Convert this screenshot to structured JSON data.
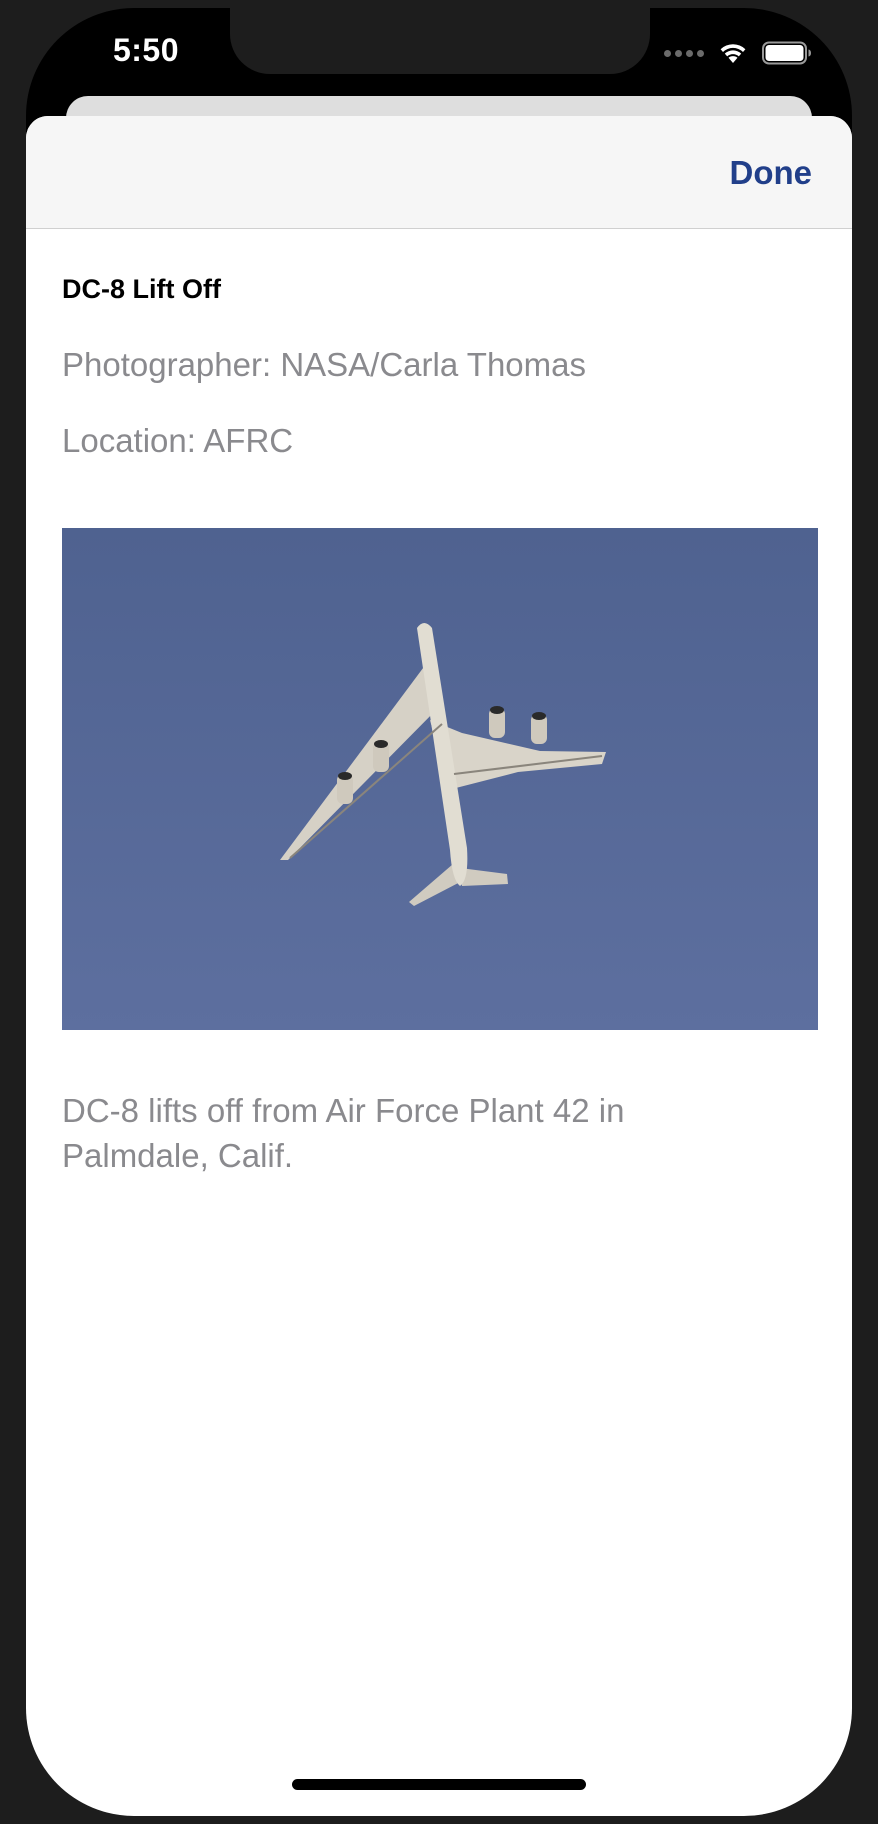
{
  "status_bar": {
    "time": "5:50"
  },
  "nav": {
    "done_label": "Done"
  },
  "photo_detail": {
    "title": "DC-8 Lift Off",
    "photographer": "Photographer: NASA/Carla Thomas",
    "location": "Location: AFRC",
    "caption": "DC-8 lifts off from Air Force Plant 42 in Palmdale, Calif."
  },
  "colors": {
    "accent": "#213f8a",
    "secondary_text": "#8a8a8e",
    "sky": "#56699a"
  },
  "icons": [
    "cellular-signal-icon",
    "wifi-icon",
    "battery-icon"
  ]
}
